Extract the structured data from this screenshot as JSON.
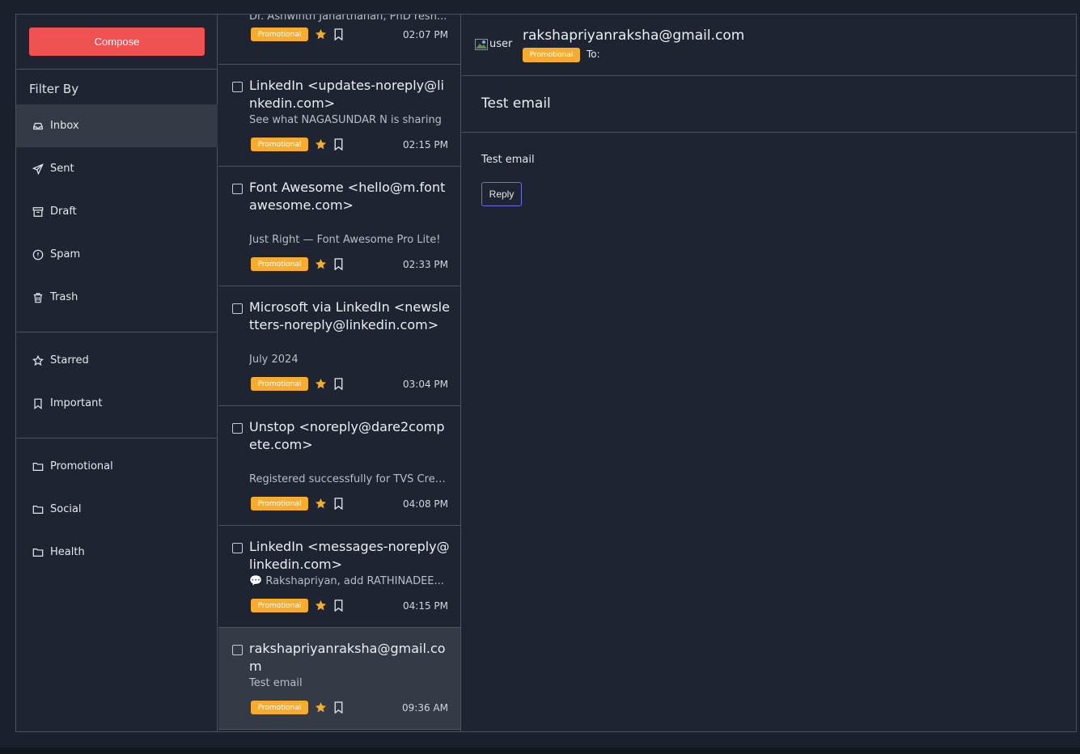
{
  "sidebar": {
    "compose_label": "Compose",
    "filter_title": "Filter By",
    "nav": [
      {
        "label": "Inbox",
        "icon": "inbox-icon"
      },
      {
        "label": "Sent",
        "icon": "send-icon"
      },
      {
        "label": "Draft",
        "icon": "archive-icon"
      },
      {
        "label": "Spam",
        "icon": "alert-circle-icon"
      },
      {
        "label": "Trash",
        "icon": "trash-icon"
      }
    ],
    "marks": [
      {
        "label": "Starred",
        "icon": "star-outline-icon"
      },
      {
        "label": "Important",
        "icon": "bookmark-icon"
      }
    ],
    "folders": [
      {
        "label": "Promotional",
        "icon": "folder-icon"
      },
      {
        "label": "Social",
        "icon": "folder-icon"
      },
      {
        "label": "Health",
        "icon": "folder-icon"
      }
    ]
  },
  "emails": [
    {
      "sender": "",
      "preview": "Dr. Ashwinth Janarthanan, PhD resh...",
      "badge": "Promotional",
      "time": "02:07 PM"
    },
    {
      "sender": "LinkedIn <updates-noreply@linkedin.com>",
      "preview": "See what NAGASUNDAR N is sharing",
      "badge": "Promotional",
      "time": "02:15 PM"
    },
    {
      "sender": "Font Awesome <hello@m.fontawesome.com>",
      "preview": "Just Right — Font Awesome Pro Lite!",
      "badge": "Promotional",
      "time": "02:33 PM"
    },
    {
      "sender": "Microsoft via LinkedIn <newsletters-noreply@linkedin.com>",
      "preview": "July 2024",
      "badge": "Promotional",
      "time": "03:04 PM"
    },
    {
      "sender": "Unstop <noreply@dare2compete.com>",
      "preview": "Registered successfully for TVS Cred...",
      "badge": "Promotional",
      "time": "04:08 PM"
    },
    {
      "sender": "LinkedIn <messages-noreply@linkedin.com>",
      "preview": "💬 Rakshapriyan, add RATHINADEE...",
      "badge": "Promotional",
      "time": "04:15 PM"
    },
    {
      "sender": "rakshapriyanraksha@gmail.com",
      "preview": "Test email",
      "badge": "Promotional",
      "time": "09:36 AM"
    }
  ],
  "detail": {
    "avatar_alt": "user",
    "from": "rakshapriyanraksha@gmail.com",
    "badge": "Promotional",
    "to_label": "To:",
    "subject": "Test email",
    "body": "Test email",
    "reply_label": "Reply"
  },
  "colors": {
    "compose": "#f05252",
    "badge": "#f5ac2f",
    "star": "#f5ac2f",
    "reply_border": "#6d6fe0",
    "background": "#1e2431",
    "active_row": "#343b47"
  }
}
